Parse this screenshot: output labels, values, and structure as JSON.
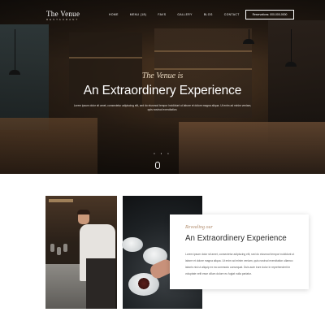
{
  "brand": {
    "title": "The Venue",
    "subtitle": "RESTAURANT"
  },
  "nav": {
    "links": [
      "HOME",
      "MENU (18)",
      "FAVS",
      "GALLERY",
      "BLOG",
      "CONTACT"
    ],
    "reserve_label": "Reservations: 000-000-0000"
  },
  "hero": {
    "script": "The Venue is",
    "title": "An Extraordinery Experience",
    "description": "Lorem ipsum dolor sit amet, consectetur adipiscing elit, sed do eiusmod tempor incididunt ut labore et dolore magna aliqua. Ut enim ad minim veniam, quis nostrud exercitation.",
    "dots": "• • •"
  },
  "intro_card": {
    "script": "Revealing our",
    "title": "An Extraordinery Experience",
    "body": "Lorem ipsum dolor sit amet, consectetur adipiscing elit, sed do eiusmod tempor incididunt ut labore et dolore magna aliqua. Ut enim ad minim veniam, quis nostrud exercitation ullamco laboris nisi ut aliquip ex ea commodo consequat. Duis aute irure dolor in reprehenderit in voluptate velit esse cillum dolore eu fugiat nulla pariatur."
  },
  "colors": {
    "accent": "#b08a6a",
    "hero_overlay": "#1d1712",
    "heading": "#2a2a2a"
  }
}
